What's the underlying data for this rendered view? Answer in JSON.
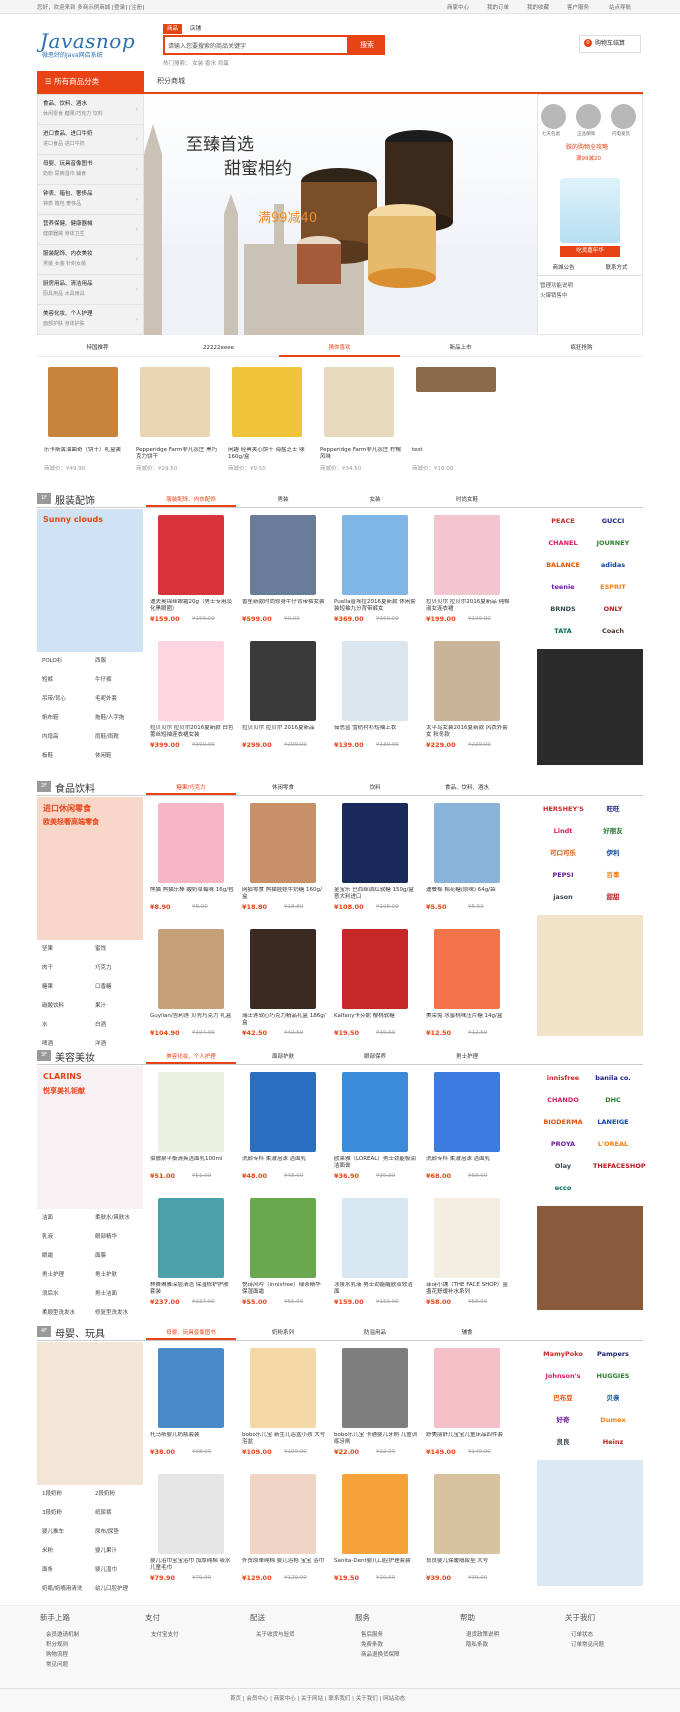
{
  "topbar": {
    "welcome": "您好，欢迎来到 多商示例商城 [登录] [注册]",
    "links": [
      "商家中心",
      "我的订单",
      "我的收藏",
      "客户服务",
      "站点导航"
    ]
  },
  "logo": {
    "text": "Javasnop",
    "sub": "微思好的Java网店系统"
  },
  "search": {
    "tabs": [
      "商品",
      "店铺"
    ],
    "placeholder": "请输入您要搜索的商品关键字",
    "button": "搜索",
    "hot": "热门搜索：  女装  香水  鸡蛋"
  },
  "cart": {
    "label": "购物车结算",
    "count": "0"
  },
  "nav": {
    "category_title": "所有商品分类",
    "links": [
      "积分商城"
    ]
  },
  "categories": [
    {
      "title": "食品、饮料、酒水",
      "sub": "休闲零食  糖果/巧克力  饮料"
    },
    {
      "title": "进口食品、进口牛奶",
      "sub": "进口食品  进口牛奶"
    },
    {
      "title": "母婴、玩具音像图书",
      "sub": "奶粉  尿裤湿巾  辅食"
    },
    {
      "title": "钟表、箱包、奢侈品",
      "sub": "钟表  箱包  奢侈品"
    },
    {
      "title": "营养保健、健康器械",
      "sub": "健康器械  身体卫生"
    },
    {
      "title": "服装配饰、内衣美妆",
      "sub": "男装  女装  针织女装"
    },
    {
      "title": "厨房用品、清洁用品",
      "sub": "厨具用品  水具用具"
    },
    {
      "title": "美容化妆、个人护理",
      "sub": "面部护肤  身体护肤"
    }
  ],
  "banner": {
    "line1": "至臻首选",
    "line2": "甜蜜相约",
    "promo": "满99减40"
  },
  "right_panel": {
    "services": [
      "七天包退",
      "正品保障",
      "闪电发货"
    ],
    "promo": "踩的购物全攻略",
    "promo2": "满99减20",
    "promo3": "吃货嘉年华",
    "tabs": [
      "商城公告",
      "联系方式"
    ],
    "notices": [
      "管理功能说明",
      "火爆销售中"
    ]
  },
  "promo_tabs": [
    "特国推荐",
    "22222eeee",
    "猜你喜欢",
    "新品上市",
    "疯狂抢购"
  ],
  "guess_products": [
    {
      "name": "乐卡斯黄油曲奇（饼干）礼盒装",
      "price": "商城价：¥49.90"
    },
    {
      "name": "Pepperidge Farm非凡农庄 黑巧克力饼干",
      "price": "商城价：¥29.50"
    },
    {
      "name": "闲趣 经典夹心饼干 海盐芝士 味 160g/盒",
      "price": "商城价：¥9.50"
    },
    {
      "name": "Pepperidge Farm非凡农庄 柠檬风味",
      "price": "商城价：¥34.50"
    },
    {
      "name": "test",
      "price": "商城价：¥10.00"
    }
  ],
  "floors": [
    {
      "num": "1F",
      "title": "服装配饰",
      "tabs": [
        "服装配饰、内衣配饰",
        "男装",
        "女装",
        "时尚女鞋"
      ],
      "left_text": "Sunny clouds",
      "keywords": [
        "POLO衫",
        "西服",
        "短裤",
        "牛仔裤",
        "吊带/背心",
        "毛呢外套",
        "帆布鞋",
        "拖鞋/人字拖",
        "内增高",
        "雨鞋/雨靴",
        "板鞋",
        "休闲鞋"
      ],
      "products": [
        {
          "name": "迪夫奥锦丝眼霜20g（男士专用淡化黑眼圈）",
          "price": "¥159.00",
          "old": "¥159.00"
        },
        {
          "name": "香笙新款时尚修身牛仔背带裤女装",
          "price": "¥599.00",
          "old": "¥0.00"
        },
        {
          "name": "Puella普埃拉2016夏新款 休闲套装短袖九分背带裤女",
          "price": "¥369.00",
          "old": "¥369.00"
        },
        {
          "name": "拉贝贝尔 拉贝尔2016夏新品 纯棉淑女连衣裙",
          "price": "¥199.00",
          "old": "¥199.00"
        },
        {
          "name": "拉贝贝尔 拉贝尔2016夏新款 白色蕾丝短袖连衣裙女装",
          "price": "¥399.00",
          "old": "¥399.00"
        },
        {
          "name": "拉贝贝尔 拉贝尔 2016夏新品",
          "price": "¥299.00",
          "old": "¥299.00"
        },
        {
          "name": "茹思蓝 雪纺衬衫短袖上衣",
          "price": "¥139.00",
          "old": "¥139.00"
        },
        {
          "name": "太平鸟女装2016夏新款 风衣外套女 秋冬款",
          "price": "¥229.00",
          "old": "¥229.00"
        }
      ],
      "brands": [
        "PEACE",
        "GUCCI",
        "CHANEL",
        "JOURNEY",
        "BALANCE",
        "adidas",
        "teenie",
        "ESPRIT",
        "BRNDS",
        "ONLY",
        "TATA",
        "Coach"
      ]
    },
    {
      "num": "2F",
      "title": "食品饮料",
      "tabs": [
        "糖果/巧克力",
        "休闲零食",
        "饮料",
        "食品、饮料、酒水"
      ],
      "left_text": "进口休闲零食",
      "left_text2": "欧美轻奢高端零食",
      "keywords": [
        "坚果",
        "蜜饯",
        "肉干",
        "巧克力",
        "糖果",
        "口香糖",
        "碳酸饮料",
        "果汁",
        "水",
        "白酒",
        "啤酒",
        "洋酒"
      ],
      "products": [
        {
          "name": "熊猫 熊猫乐棒 酸奶草莓味 16g/包",
          "price": "¥8.90",
          "old": "¥8.90"
        },
        {
          "name": "网狐零食 熊猫娃娃牛奶糖 160g/盒",
          "price": "¥18.80",
          "old": "¥18.80"
        },
        {
          "name": "金宝乐 巴西丝绸红软糖 150g/盒 意大利进口",
          "price": "¥108.00",
          "old": "¥108.00"
        },
        {
          "name": "迪餐棉 棉花糖(原味) 64g/袋",
          "price": "¥5.50",
          "old": "¥5.50"
        },
        {
          "name": "Guylian/吉利莲 贝壳巧克力 礼盒",
          "price": "¥104.90",
          "old": "¥104.90"
        },
        {
          "name": "瑞士莲软心巧克力精品礼盒 186g/盒",
          "price": "¥42.50",
          "old": "¥42.50"
        },
        {
          "name": "Kalfany卡芬妮 樱桃软糖",
          "price": "¥19.50",
          "old": "¥19.50"
        },
        {
          "name": "美荣兔 水蜜桃味压片糖 14g/盒",
          "price": "¥12.50",
          "old": "¥12.50"
        }
      ],
      "brands": [
        "HERSHEY'S",
        "旺旺",
        "Lindt",
        "好丽友",
        "可口可乐",
        "伊利",
        "PEPSI",
        "百事",
        "jason",
        "甜甜"
      ]
    },
    {
      "num": "3F",
      "title": "美容美妆",
      "tabs": [
        "美容化妆、个人护理",
        "面部护肤",
        "眼部保养",
        "男士护理"
      ],
      "left_text": "CLARINS",
      "left_text2": "悦享美礼钜献",
      "keywords": [
        "洁面",
        "柔肤水/爽肤水",
        "乳液",
        "眼部精华",
        "眼霜",
        "面膜",
        "男士护理",
        "男士护肤",
        "须后水",
        "男士洁面",
        "柔顺型洗发水",
        "修复型洗发水"
      ],
      "products": [
        {
          "name": "伯傲泉平衡清爽洁面乳100ml",
          "price": "¥51.00",
          "old": "¥51.00"
        },
        {
          "name": "洗颜专科 柔澈泡沫 洁面乳",
          "price": "¥48.00",
          "old": "¥48.00"
        },
        {
          "name": "欧莱雅（LOREAL）男士劲能极润洁面膏",
          "price": "¥36.90",
          "old": "¥39.90"
        },
        {
          "name": "洗颜专科 柔澈泡沫 洁面乳",
          "price": "¥68.00",
          "old": "¥68.00"
        },
        {
          "name": "林赛琳雅深层清洁 保湿修护护肤套装",
          "price": "¥237.00",
          "old": "¥237.00"
        },
        {
          "name": "悦诗风吟（innisfree）绿茶精华保湿面霜",
          "price": "¥55.00",
          "old": "¥55.00"
        },
        {
          "name": "冰泉水乳液 男士劲能醒肤双效洁面",
          "price": "¥159.00",
          "old": "¥159.00"
        },
        {
          "name": "菲诗小铺（THE FACE SHOP）金盏花舒缓补水系列",
          "price": "¥58.00",
          "old": "¥58.00"
        }
      ],
      "brands": [
        "innisfree",
        "banila co.",
        "CHANDO",
        "DHC",
        "BIODERMA",
        "LANEIGE",
        "PROYA",
        "L'OREAL",
        "Olay",
        "THEFACESHOP",
        "ecco"
      ]
    },
    {
      "num": "4F",
      "title": "母婴、玩具",
      "tabs": [
        "母婴、玩具音像图书",
        "奶粉系列",
        "防溢用品",
        "辅食"
      ],
      "keywords": [
        "1段奶粉",
        "2段奶粉",
        "3段奶粉",
        "纸尿裤",
        "婴儿推车",
        "尿布/尿垫",
        "米粉",
        "婴儿果汁",
        "面条",
        "婴儿湿巾",
        "奶瓶/奶嘴用清洗",
        "幼儿口腔护理"
      ],
      "products": [
        {
          "name": "托马斯婴儿奶瓶套装",
          "price": "¥38.00",
          "old": "¥38.00"
        },
        {
          "name": "bobo乐儿宝 新生儿浴盆小孩 大号浴盆",
          "price": "¥109.00",
          "old": "¥109.00"
        },
        {
          "name": "bobo乐儿宝 卡通婴儿牙刷 儿童训练牙刷",
          "price": "¥22.00",
          "old": "¥22.00"
        },
        {
          "name": "舒美丽舒儿宝宝儿童床品四件套",
          "price": "¥149.00",
          "old": "¥149.00"
        },
        {
          "name": "婴儿浴巾宝宝浴巾 加厚纯棉 吸水儿童毛巾",
          "price": "¥79.90",
          "old": "¥79.90"
        },
        {
          "name": "外贸原单纯棉 婴儿浴袍 宝宝 浴巾",
          "price": "¥129.00",
          "old": "¥129.00"
        },
        {
          "name": "Sanita-Dent婴儿口腔护理套装",
          "price": "¥19.50",
          "old": "¥19.50"
        },
        {
          "name": "良良婴儿保暖隔尿垫 大号",
          "price": "¥39.00",
          "old": "¥39.00"
        }
      ],
      "brands": [
        "MamyPoko",
        "Pampers",
        "Johnson's",
        "HUGGIES",
        "巴布豆",
        "贝亲",
        "好奇",
        "Dumex",
        "良良",
        "Heinz"
      ]
    }
  ],
  "footer": {
    "cols": [
      {
        "title": "新手上路",
        "items": [
          "会员邀请机制",
          "积分规则",
          "购物流程",
          "常见问题"
        ]
      },
      {
        "title": "支付",
        "items": [
          "支付宝支付"
        ]
      },
      {
        "title": "配送",
        "items": [
          "关于收货与验货"
        ]
      },
      {
        "title": "服务",
        "items": [
          "售后服务",
          "免费条款",
          "商品退换货保障"
        ]
      },
      {
        "title": "帮助",
        "items": [
          "退货政策说明",
          "隐私条款"
        ]
      },
      {
        "title": "关于我们",
        "items": [
          "订单状态",
          "订单常见问题"
        ]
      }
    ],
    "bottom": "首页  |  会员中心  |  商家中心  |  关于网站  |  联系我们  |  关于我们  |  网站动态"
  },
  "colors": {
    "accent": "#e84315",
    "logo": "#2a6fb3"
  }
}
